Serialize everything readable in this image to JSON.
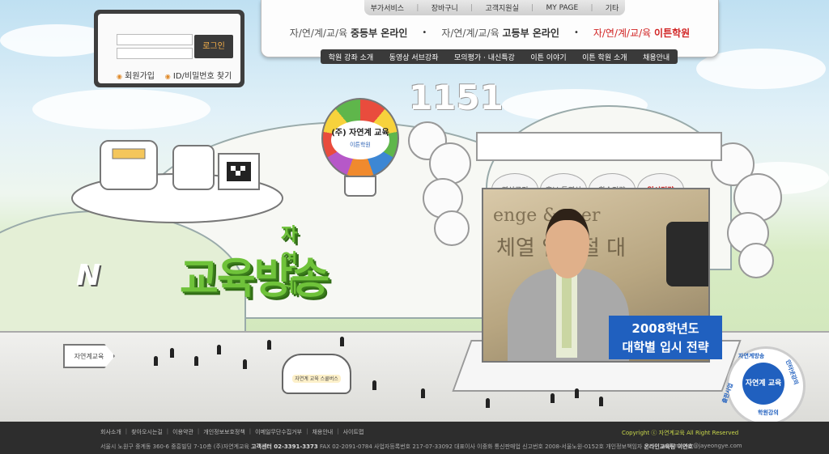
{
  "login": {
    "button_label": "로그인",
    "join_label": "회원가입",
    "find_label": "ID/비밀번호 찾기"
  },
  "utility": [
    "부가서비스",
    "장바구니",
    "고객지원실",
    "MY PAGE",
    "기타"
  ],
  "brands": [
    {
      "prefix": "자/연/계/교/육",
      "name": "중등부 온라인",
      "active": false
    },
    {
      "prefix": "자/연/계/교/육",
      "name": "고등부 온라인",
      "active": false
    },
    {
      "prefix": "자/연/계/교/육",
      "name": "이튼학원",
      "active": true
    }
  ],
  "menu": [
    "학원 강좌 소개",
    "동영상 서브강좌",
    "모의평가 · 내신특강",
    "이튼 이야기",
    "이튼 학원 소개",
    "채용안내"
  ],
  "balloon": {
    "title": "(주) 자연계 교육",
    "sub": "이튼학원"
  },
  "stage": {
    "tabs": [
      {
        "label": "영상공지",
        "active": false
      },
      {
        "label": "홍보 동영상",
        "active": false
      },
      {
        "label": "학습전략",
        "active": false
      },
      {
        "label": "입시전략",
        "active": true
      }
    ],
    "video_sign": "enge & ...er",
    "video_sign2": "체열 입시절 대",
    "caption_line1": "2008학년도",
    "caption_line2": "대학별 입시 전략"
  },
  "title3d": {
    "small": "자연계",
    "big": "교육방송"
  },
  "numbers": "1151",
  "bus_plate": "자연계 교육 스쿨버스",
  "sign_arrow": "자연계교육",
  "badge": {
    "core": "자연계 교육",
    "ring_top": "자연계방송",
    "ring_right": "인터넷강의",
    "ring_bottom": "학원강의",
    "ring_left": "출판사업"
  },
  "footer": {
    "links": [
      "회사소개",
      "찾아오시는길",
      "이용약관",
      "개인정보보호정책",
      "이메일무단수집거부",
      "채용안내",
      "사이트맵"
    ],
    "copyright": "Copyright ⓒ 자연계교육 All Right Reserved",
    "address": "서울시 노원구 중계동 360-6 중흥빌딩 7-10층 (주)자연계교육",
    "center_label": "고객센터 02-3391-3373",
    "biz_info": "FAX 02-2091-0784 사업자등록번호 217-07-33092 대표이사 이중화 통신판매업 신고번호 2008-서울노원-0152호 개인정보책임자",
    "officer": "온라인교육팀 이연호",
    "email": "webmaster@jayeongye.com"
  },
  "colors": {
    "accent_red": "#d12323",
    "brand_blue": "#2060bf",
    "title_green": "#6fc23a",
    "footer_bg": "#2d2d2d"
  }
}
